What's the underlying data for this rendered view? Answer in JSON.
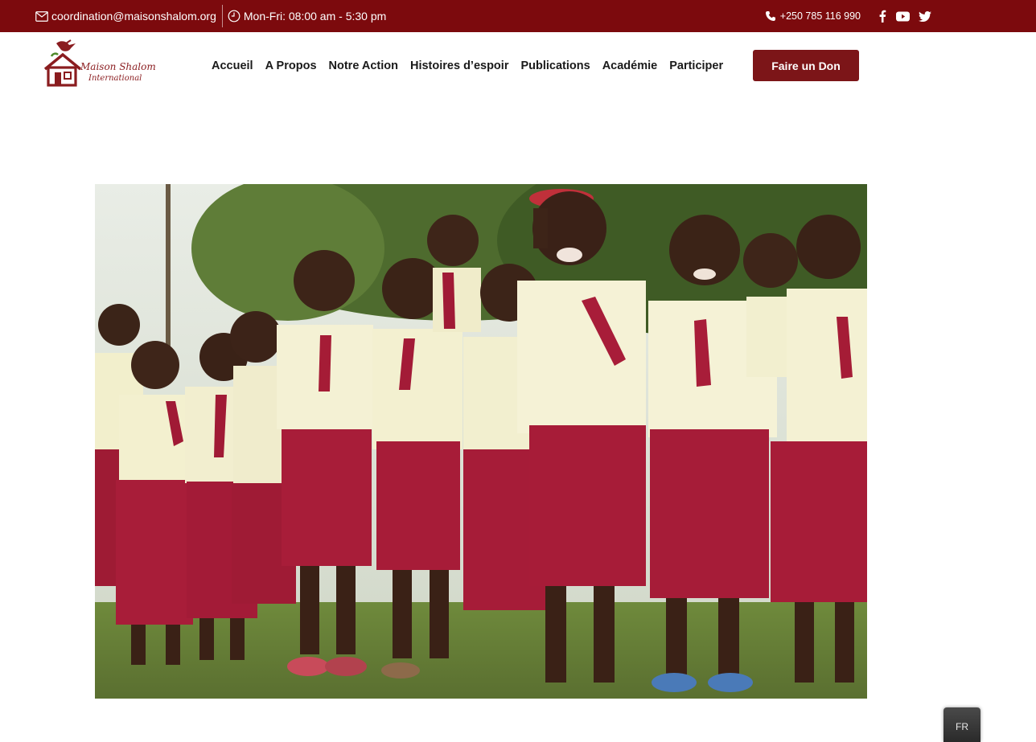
{
  "topbar": {
    "email": "coordination@maisonshalom.org",
    "hours": "Mon-Fri: 08:00 am - 5:30 pm",
    "phone": "+250 785 116 990",
    "social": [
      "facebook-icon",
      "youtube-icon",
      "twitter-icon"
    ]
  },
  "header": {
    "logo_line1": "Maison Shalom",
    "logo_line2": "International",
    "nav": [
      "Accueil",
      "A Propos",
      "Notre Action",
      "Histoires d’espoir",
      "Publications",
      "Académie",
      "Participer"
    ],
    "donate_label": "Faire un Don"
  },
  "hero": {
    "image_icon": "photo-children-in-uniforms"
  },
  "language": {
    "current": "FR"
  },
  "colors": {
    "brand": "#7c0a0d",
    "button": "#7c1518"
  }
}
